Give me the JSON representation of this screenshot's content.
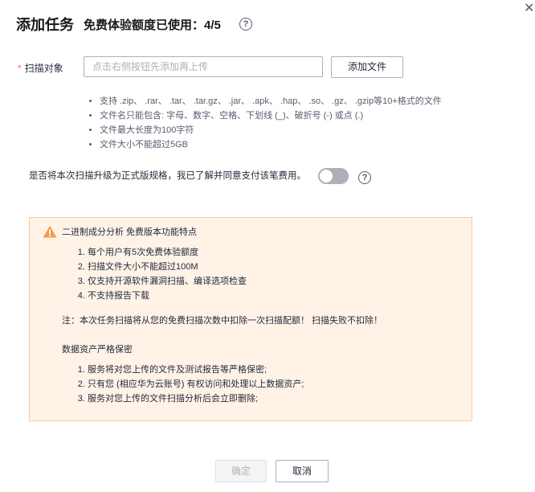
{
  "dialog": {
    "title": "添加任务",
    "quota": "免费体验额度已使用：4/5",
    "help_glyph": "?",
    "close_glyph": "✕"
  },
  "upload": {
    "required_mark": "*",
    "label": "扫描对象",
    "placeholder": "点击右侧按钮先添加再上传",
    "add_button": "添加文件"
  },
  "rules": [
    "支持 .zip、 .rar、 .tar、 .tar.gz、 .jar、 .apk、 .hap、 .so、 .gz、 .gzip等10+格式的文件",
    "文件名只能包含: 字母、数字、空格、下划线 (_)、破折号 (-) 或点 (.)",
    "文件最大长度为100字符",
    "文件大小不能超过5GB"
  ],
  "upgrade": {
    "label": "是否将本次扫描升级为正式版规格，我已了解并同意支付该笔费用。",
    "enabled": false
  },
  "notice": {
    "colors": {
      "background": "#fff3e8",
      "border": "#ffc89e",
      "warning_icon": "#fa9841"
    },
    "icon": "warning-triangle-icon",
    "title": "二进制成分分析 免费版本功能特点",
    "features": [
      "每个用户有5次免费体验额度",
      "扫描文件大小不能超过100M",
      "仅支持开源软件漏洞扫描、编译选项检查",
      "不支持报告下载"
    ],
    "note": "注：本次任务扫描将从您的免费扫描次数中扣除一次扫描配额！ 扫描失败不扣除！",
    "security_title": "数据资产严格保密",
    "security_items": [
      "服务将对您上传的文件及测试报告等严格保密;",
      "只有您 (相应华为云账号) 有权访问和处理以上数据资产;",
      "服务对您上传的文件扫描分析后会立即删除;"
    ]
  },
  "footer": {
    "ok_button": "确定",
    "cancel_button": "取消"
  }
}
